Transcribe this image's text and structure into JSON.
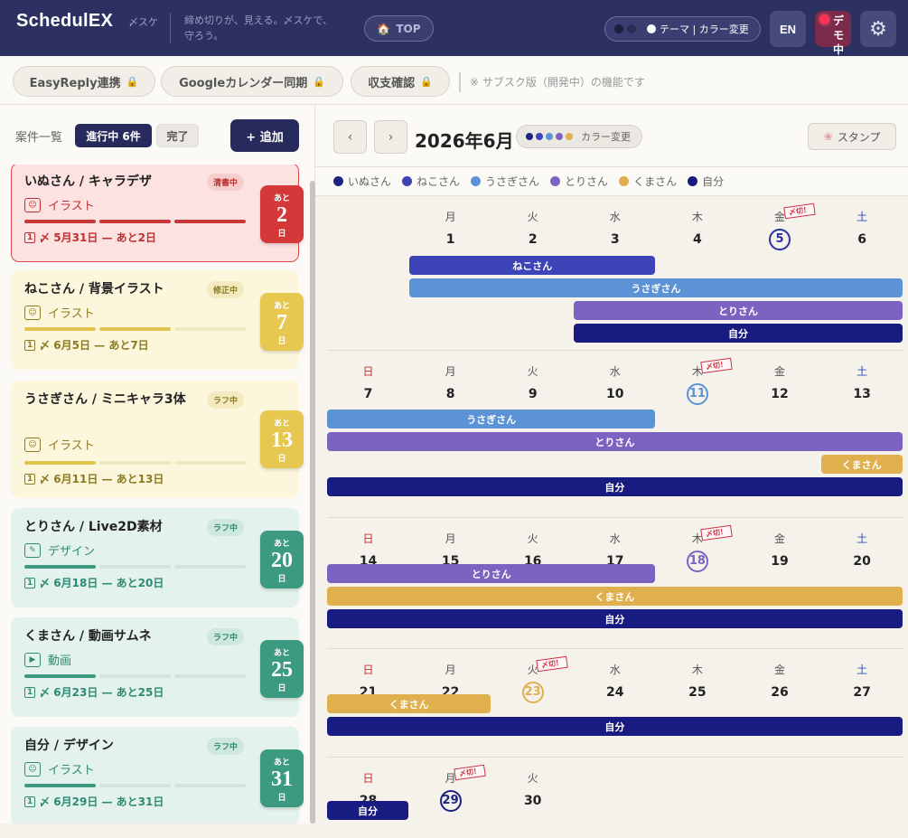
{
  "header": {
    "logo": "SchedulEX",
    "logo_sub": "〆スケ",
    "tagline": "締め切りが、見える。〆スケで、守ろう。",
    "top_label": "TOP",
    "theme_label": "テーマ | カラー変更",
    "lang_label": "EN",
    "demo_label": "デモ中"
  },
  "subbar": {
    "pills": [
      "EasyReply連携",
      "Googleカレンダー同期",
      "収支確認"
    ],
    "note": "※ サブスク版（開発中）の機能です"
  },
  "list_header": {
    "title": "案件一覧",
    "tab_active": "進行中 6件",
    "tab_done": "完了",
    "add_label": "+ 追加"
  },
  "projects": [
    {
      "title": "いぬさん / キャラデザ",
      "status": "清書中",
      "category": "イラスト",
      "due": "5月31日 — あと2日",
      "days": "2",
      "progress": 3,
      "theme": "red"
    },
    {
      "title": "ねこさん / 背景イラスト",
      "status": "修正中",
      "category": "イラスト",
      "due": "6月5日 — あと7日",
      "days": "7",
      "progress": 2,
      "theme": "yellow"
    },
    {
      "title": "うさぎさん / ミニキャラ3体",
      "status": "ラフ中",
      "category": "イラスト",
      "due": "6月11日 — あと13日",
      "days": "13",
      "progress": 1,
      "theme": "yellow"
    },
    {
      "title": "とりさん / Live2D素材",
      "status": "ラフ中",
      "category": "デザイン",
      "due": "6月18日 — あと20日",
      "days": "20",
      "progress": 1,
      "theme": "green"
    },
    {
      "title": "くまさん / 動画サムネ",
      "status": "ラフ中",
      "category": "動画",
      "due": "6月23日 — あと25日",
      "days": "25",
      "progress": 1,
      "theme": "green"
    },
    {
      "title": "自分 / デザイン",
      "status": "ラフ中",
      "category": "イラスト",
      "due": "6月29日 — あと31日",
      "days": "31",
      "progress": 1,
      "theme": "green"
    }
  ],
  "countdown_prefix": "あと",
  "countdown_suffix": "日",
  "calendar": {
    "month": "2026年6月",
    "color_label": "カラー変更",
    "stamp_label": "スタンプ",
    "legend": [
      {
        "name": "いぬさん",
        "color": "#1d2380"
      },
      {
        "name": "ねこさん",
        "color": "#3d44b8"
      },
      {
        "name": "うさぎさん",
        "color": "#5b93d6"
      },
      {
        "name": "とりさん",
        "color": "#7c63c2"
      },
      {
        "name": "くまさん",
        "color": "#e0b04e"
      },
      {
        "name": "自分",
        "color": "#181c80"
      }
    ],
    "weekdays": [
      "日",
      "月",
      "火",
      "水",
      "木",
      "金",
      "土"
    ],
    "deadline_label": "〆切！"
  }
}
